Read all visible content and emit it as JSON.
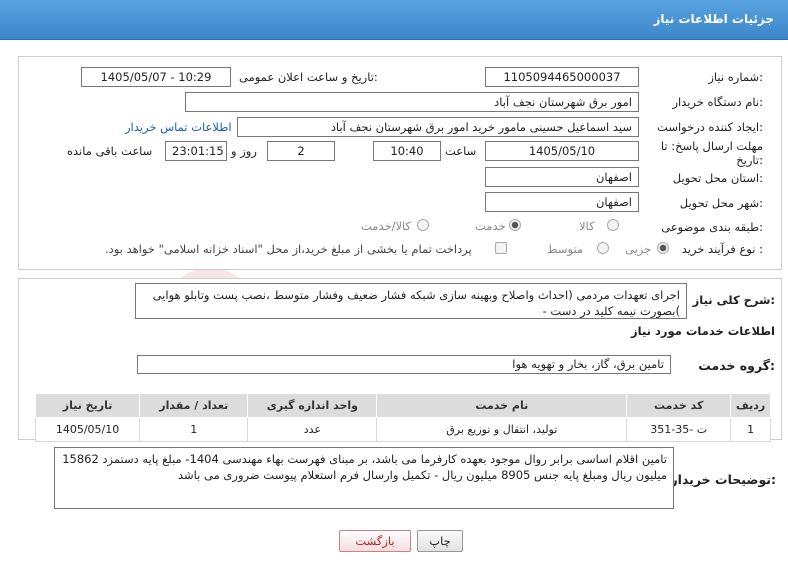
{
  "header": {
    "title": "جزئیات اطلاعات نیاز"
  },
  "form": {
    "need_number_label": "شماره نیاز:",
    "need_number": "1105094465000037",
    "announce_label": "تاریخ و ساعت اعلان عمومی:",
    "announce_value": "1405/05/07 - 10:29",
    "buyer_org_label": "نام دستگاه خریدار:",
    "buyer_org": "امور برق شهرستان نجف آباد",
    "creator_label": "ایجاد کننده درخواست:",
    "creator": "سید اسماعیل  حسینی  مامور خرید  امور برق شهرستان نجف آباد",
    "contact_link": "اطلاعات تماس خریدار",
    "deadline_label_1": "مهلت ارسال پاسخ: تا",
    "deadline_label_2": "تاریخ:",
    "deadline_date": "1405/05/10",
    "time_label": "ساعت",
    "deadline_time": "10:40",
    "days_value": "2",
    "days_label": "روز و",
    "remaining_time": "23:01:15",
    "remaining_label": "ساعت باقی مانده",
    "province_label": "استان محل تحویل:",
    "province": "اصفهان",
    "city_label": "شهر محل تحویل:",
    "city": "اصفهان",
    "category_label": "طبقه بندی موضوعی:",
    "category_options": [
      "کالا",
      "خدمت",
      "کالا/خدمت"
    ],
    "category_selected": "خدمت",
    "process_label": "نوع فرآیند خرید :",
    "process_options": [
      "جزیی",
      "متوسط"
    ],
    "process_selected": "جزیی",
    "payment_note": "پرداخت تمام یا بخشی از مبلغ خرید،از محل \"اسناد خزانه اسلامی\" خواهد بود."
  },
  "description": {
    "label": "شرح کلی نیاز:",
    "text": "اجرای تعهدات مردمی (احداث واصلاح وبهینه سازی شبکه فشار ضعیف وفشار متوسط ،نصب پست وتابلو هوایی )بصورت نیمه کلید در دست -"
  },
  "services": {
    "section_title": "اطلاعات خدمات مورد نیاز",
    "group_label": "گروه خدمت:",
    "group_value": "تامین برق، گاز، بخار و تهویه هوا",
    "columns": [
      "ردیف",
      "کد خدمت",
      "نام خدمت",
      "واحد اندازه گیری",
      "تعداد / مقدار",
      "تاریخ نیاز"
    ],
    "rows": [
      [
        "1",
        "ت -35-351",
        "تولید، انتقال و توزیع برق",
        "عدد",
        "1",
        "1405/05/10"
      ]
    ]
  },
  "buyer_notes": {
    "label": "توضیحات خریدار:",
    "text": "تامین اقلام اساسی برابر روال موجود بعهده کارفرما می باشد، بر مبنای فهرست بهاء مهندسی 1404- مبلغ پایه دستمزد 15862 میلیون ریال ومبلغ پایه جنس 8905 میلیون ریال - تکمیل وارسال فرم استعلام پیوست ضروری می باشد"
  },
  "buttons": {
    "print": "چاپ",
    "back": "بازگشت"
  },
  "colors": {
    "header": "#3d86c8",
    "link": "#1a5fb4",
    "table_header": "#dcdcdc"
  }
}
